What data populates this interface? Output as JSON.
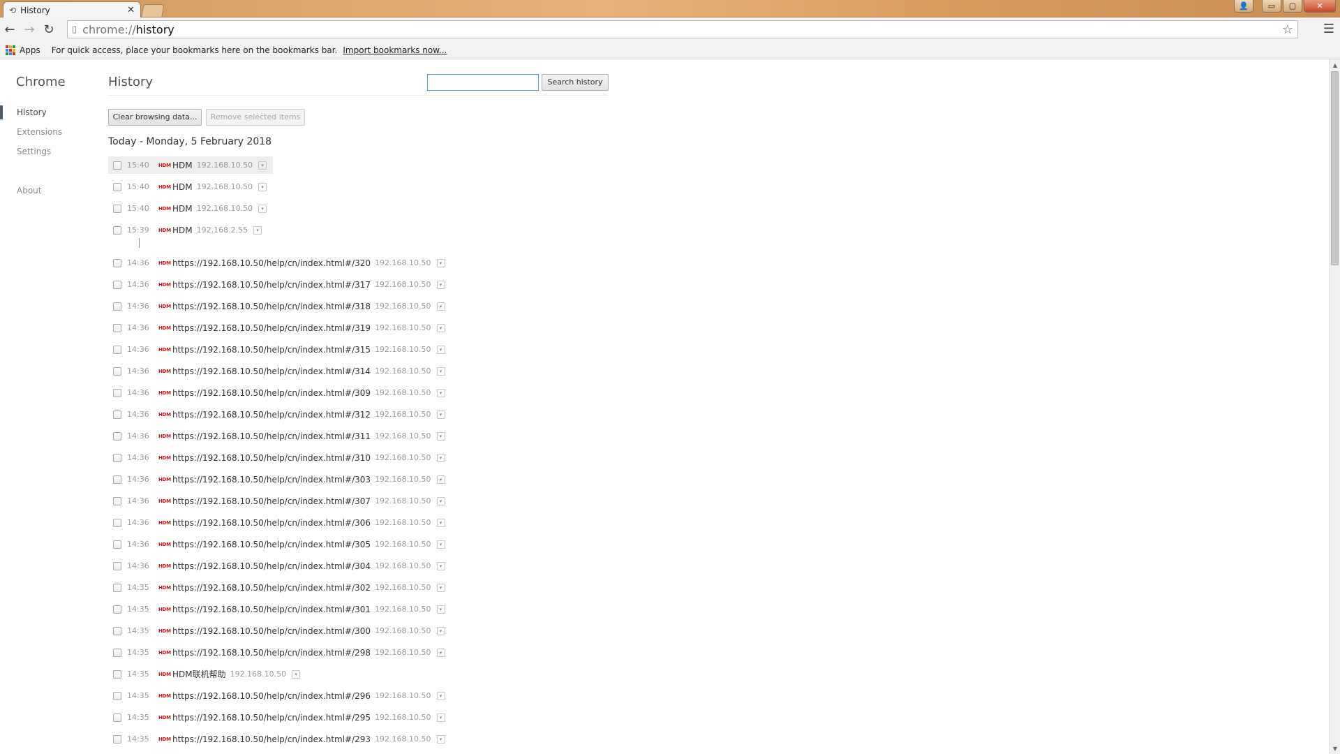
{
  "window": {
    "tab_title": "History",
    "tab_icon": "history-icon",
    "close_glyph": "✕",
    "controls": {
      "user": "👤",
      "minimize": "▭",
      "maximize": "▢",
      "close": "✕"
    }
  },
  "toolbar": {
    "back_icon": "←",
    "forward_icon": "→",
    "reload_icon": "↻",
    "url_scheme": "chrome://",
    "url_host": "history",
    "star_icon": "☆",
    "menu_icon": "☰"
  },
  "bookmarks": {
    "apps_label": "Apps",
    "hint_text": "For quick access, place your bookmarks here on the bookmarks bar.",
    "import_link": "Import bookmarks now...",
    "apps_colors": [
      "#d93025",
      "#f4b400",
      "#0f9d58",
      "#4285f4",
      "#d93025",
      "#f4b400",
      "#0f9d58",
      "#4285f4",
      "#d93025"
    ]
  },
  "sidebar": {
    "title": "Chrome",
    "items": [
      {
        "label": "History",
        "selected": true
      },
      {
        "label": "Extensions",
        "selected": false
      },
      {
        "label": "Settings",
        "selected": false
      },
      {
        "label": "About",
        "selected": false
      }
    ]
  },
  "main": {
    "title": "History",
    "search_placeholder": "",
    "search_button": "Search history",
    "clear_button": "Clear browsing data...",
    "remove_button": "Remove selected items",
    "day_heading": "Today - Monday, 5 February 2018",
    "favicon_text": "HDM",
    "dropdown_glyph": "▾",
    "entries": [
      {
        "time": "15:40",
        "title": "HDM",
        "domain": "192.168.10.50"
      },
      {
        "time": "15:40",
        "title": "HDM",
        "domain": "192.168.10.50"
      },
      {
        "time": "15:40",
        "title": "HDM",
        "domain": "192.168.10.50"
      },
      {
        "time": "15:39",
        "title": "HDM",
        "domain": "192.168.2.55"
      },
      {
        "time": "14:36",
        "title": "https://192.168.10.50/help/cn/index.html#/320",
        "domain": "192.168.10.50"
      },
      {
        "time": "14:36",
        "title": "https://192.168.10.50/help/cn/index.html#/317",
        "domain": "192.168.10.50"
      },
      {
        "time": "14:36",
        "title": "https://192.168.10.50/help/cn/index.html#/318",
        "domain": "192.168.10.50"
      },
      {
        "time": "14:36",
        "title": "https://192.168.10.50/help/cn/index.html#/319",
        "domain": "192.168.10.50"
      },
      {
        "time": "14:36",
        "title": "https://192.168.10.50/help/cn/index.html#/315",
        "domain": "192.168.10.50"
      },
      {
        "time": "14:36",
        "title": "https://192.168.10.50/help/cn/index.html#/314",
        "domain": "192.168.10.50"
      },
      {
        "time": "14:36",
        "title": "https://192.168.10.50/help/cn/index.html#/309",
        "domain": "192.168.10.50"
      },
      {
        "time": "14:36",
        "title": "https://192.168.10.50/help/cn/index.html#/312",
        "domain": "192.168.10.50"
      },
      {
        "time": "14:36",
        "title": "https://192.168.10.50/help/cn/index.html#/311",
        "domain": "192.168.10.50"
      },
      {
        "time": "14:36",
        "title": "https://192.168.10.50/help/cn/index.html#/310",
        "domain": "192.168.10.50"
      },
      {
        "time": "14:36",
        "title": "https://192.168.10.50/help/cn/index.html#/303",
        "domain": "192.168.10.50"
      },
      {
        "time": "14:36",
        "title": "https://192.168.10.50/help/cn/index.html#/307",
        "domain": "192.168.10.50"
      },
      {
        "time": "14:36",
        "title": "https://192.168.10.50/help/cn/index.html#/306",
        "domain": "192.168.10.50"
      },
      {
        "time": "14:36",
        "title": "https://192.168.10.50/help/cn/index.html#/305",
        "domain": "192.168.10.50"
      },
      {
        "time": "14:36",
        "title": "https://192.168.10.50/help/cn/index.html#/304",
        "domain": "192.168.10.50"
      },
      {
        "time": "14:35",
        "title": "https://192.168.10.50/help/cn/index.html#/302",
        "domain": "192.168.10.50"
      },
      {
        "time": "14:35",
        "title": "https://192.168.10.50/help/cn/index.html#/301",
        "domain": "192.168.10.50"
      },
      {
        "time": "14:35",
        "title": "https://192.168.10.50/help/cn/index.html#/300",
        "domain": "192.168.10.50"
      },
      {
        "time": "14:35",
        "title": "https://192.168.10.50/help/cn/index.html#/298",
        "domain": "192.168.10.50"
      },
      {
        "time": "14:35",
        "title": "HDM联机帮助",
        "domain": "192.168.10.50"
      },
      {
        "time": "14:35",
        "title": "https://192.168.10.50/help/cn/index.html#/296",
        "domain": "192.168.10.50"
      },
      {
        "time": "14:35",
        "title": "https://192.168.10.50/help/cn/index.html#/295",
        "domain": "192.168.10.50"
      },
      {
        "time": "14:35",
        "title": "https://192.168.10.50/help/cn/index.html#/293",
        "domain": "192.168.10.50"
      }
    ]
  },
  "scrollbar": {
    "up_glyph": "▲",
    "down_glyph": "▼"
  }
}
